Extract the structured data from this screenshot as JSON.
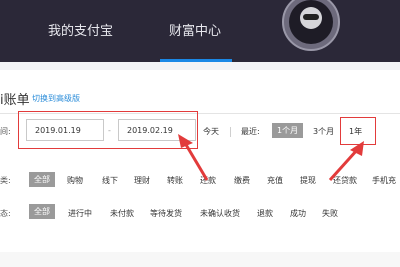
{
  "nav": {
    "items": [
      {
        "label": "我的支付宝"
      },
      {
        "label": "财富中心"
      }
    ]
  },
  "header": {
    "title": "ⅰ账单",
    "switch_link": "切换到高级版"
  },
  "time_filter": {
    "label": "间:",
    "start_date": "2019.01.19",
    "end_date": "2019.02.19",
    "separator": "-",
    "today": "今天",
    "recent_label": "最近:",
    "one_month": "1个月",
    "three_months": "3个月",
    "one_year": "1年"
  },
  "type_filter": {
    "label": "类:",
    "options": [
      "全部",
      "购物",
      "线下",
      "理财",
      "转账",
      "还款",
      "缴费",
      "充值",
      "提现",
      "还贷款",
      "手机充"
    ]
  },
  "status_filter": {
    "label": "态:",
    "options": [
      "全部",
      "进行中",
      "未付款",
      "等待发货",
      "未确认收货",
      "退款",
      "成功",
      "失败"
    ]
  },
  "colors": {
    "nav_bg": "#2b2838",
    "accent": "#1b88e6",
    "highlight": "#e23b3b",
    "pill_bg": "#9a9a9a"
  }
}
